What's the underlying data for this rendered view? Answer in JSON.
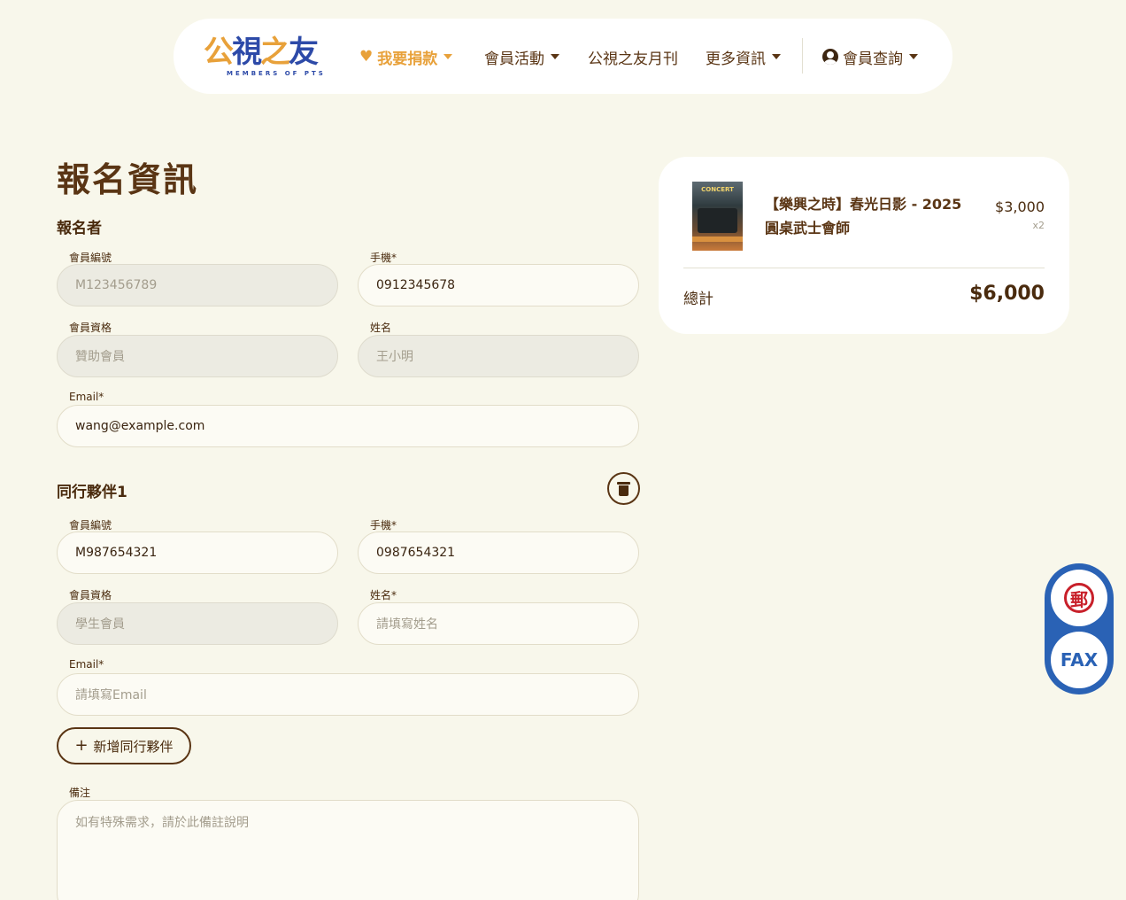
{
  "nav": {
    "logo_text": "公視之友",
    "logo_sub": "MEMBERS OF PTS",
    "donate": "我要捐款",
    "activities": "會員活動",
    "monthly": "公視之友月刊",
    "more": "更多資訊",
    "member_query": "會員查詢"
  },
  "form": {
    "title": "報名資訊",
    "registrant": {
      "heading": "報名者",
      "member_id_label": "會員編號",
      "member_id_value": "M123456789",
      "phone_label": "手機*",
      "phone_value": "0912345678",
      "membership_label": "會員資格",
      "membership_value": "贊助會員",
      "name_label": "姓名",
      "name_value": "王小明",
      "email_label": "Email*",
      "email_value": "wang@example.com"
    },
    "companion": {
      "heading": "同行夥伴1",
      "member_id_label": "會員編號",
      "member_id_value": "M987654321",
      "phone_label": "手機*",
      "phone_value": "0987654321",
      "membership_label": "會員資格",
      "membership_value": "學生會員",
      "name_label": "姓名*",
      "name_placeholder": "請填寫姓名",
      "email_label": "Email*",
      "email_placeholder": "請填寫Email"
    },
    "add_companion": "新增同行夥伴",
    "notes_label": "備注",
    "notes_placeholder": "如有特殊需求，請於此備註說明"
  },
  "cart": {
    "product_name": "【樂興之時】春光日影 - 2025 圓桌武士會師",
    "thumb_title": "CONCERT",
    "price": "$3,000",
    "qty": "x2",
    "total_label": "總計",
    "total_value": "$6,000"
  },
  "sidetools": {
    "post_glyph": "郵",
    "fax": "FAX"
  },
  "colors": {
    "background": "#f8f7eb",
    "brand_brown": "#5a3514",
    "donate_orange": "#e8a13a",
    "side_blue": "#2a62b5",
    "post_red": "#c8202a"
  }
}
